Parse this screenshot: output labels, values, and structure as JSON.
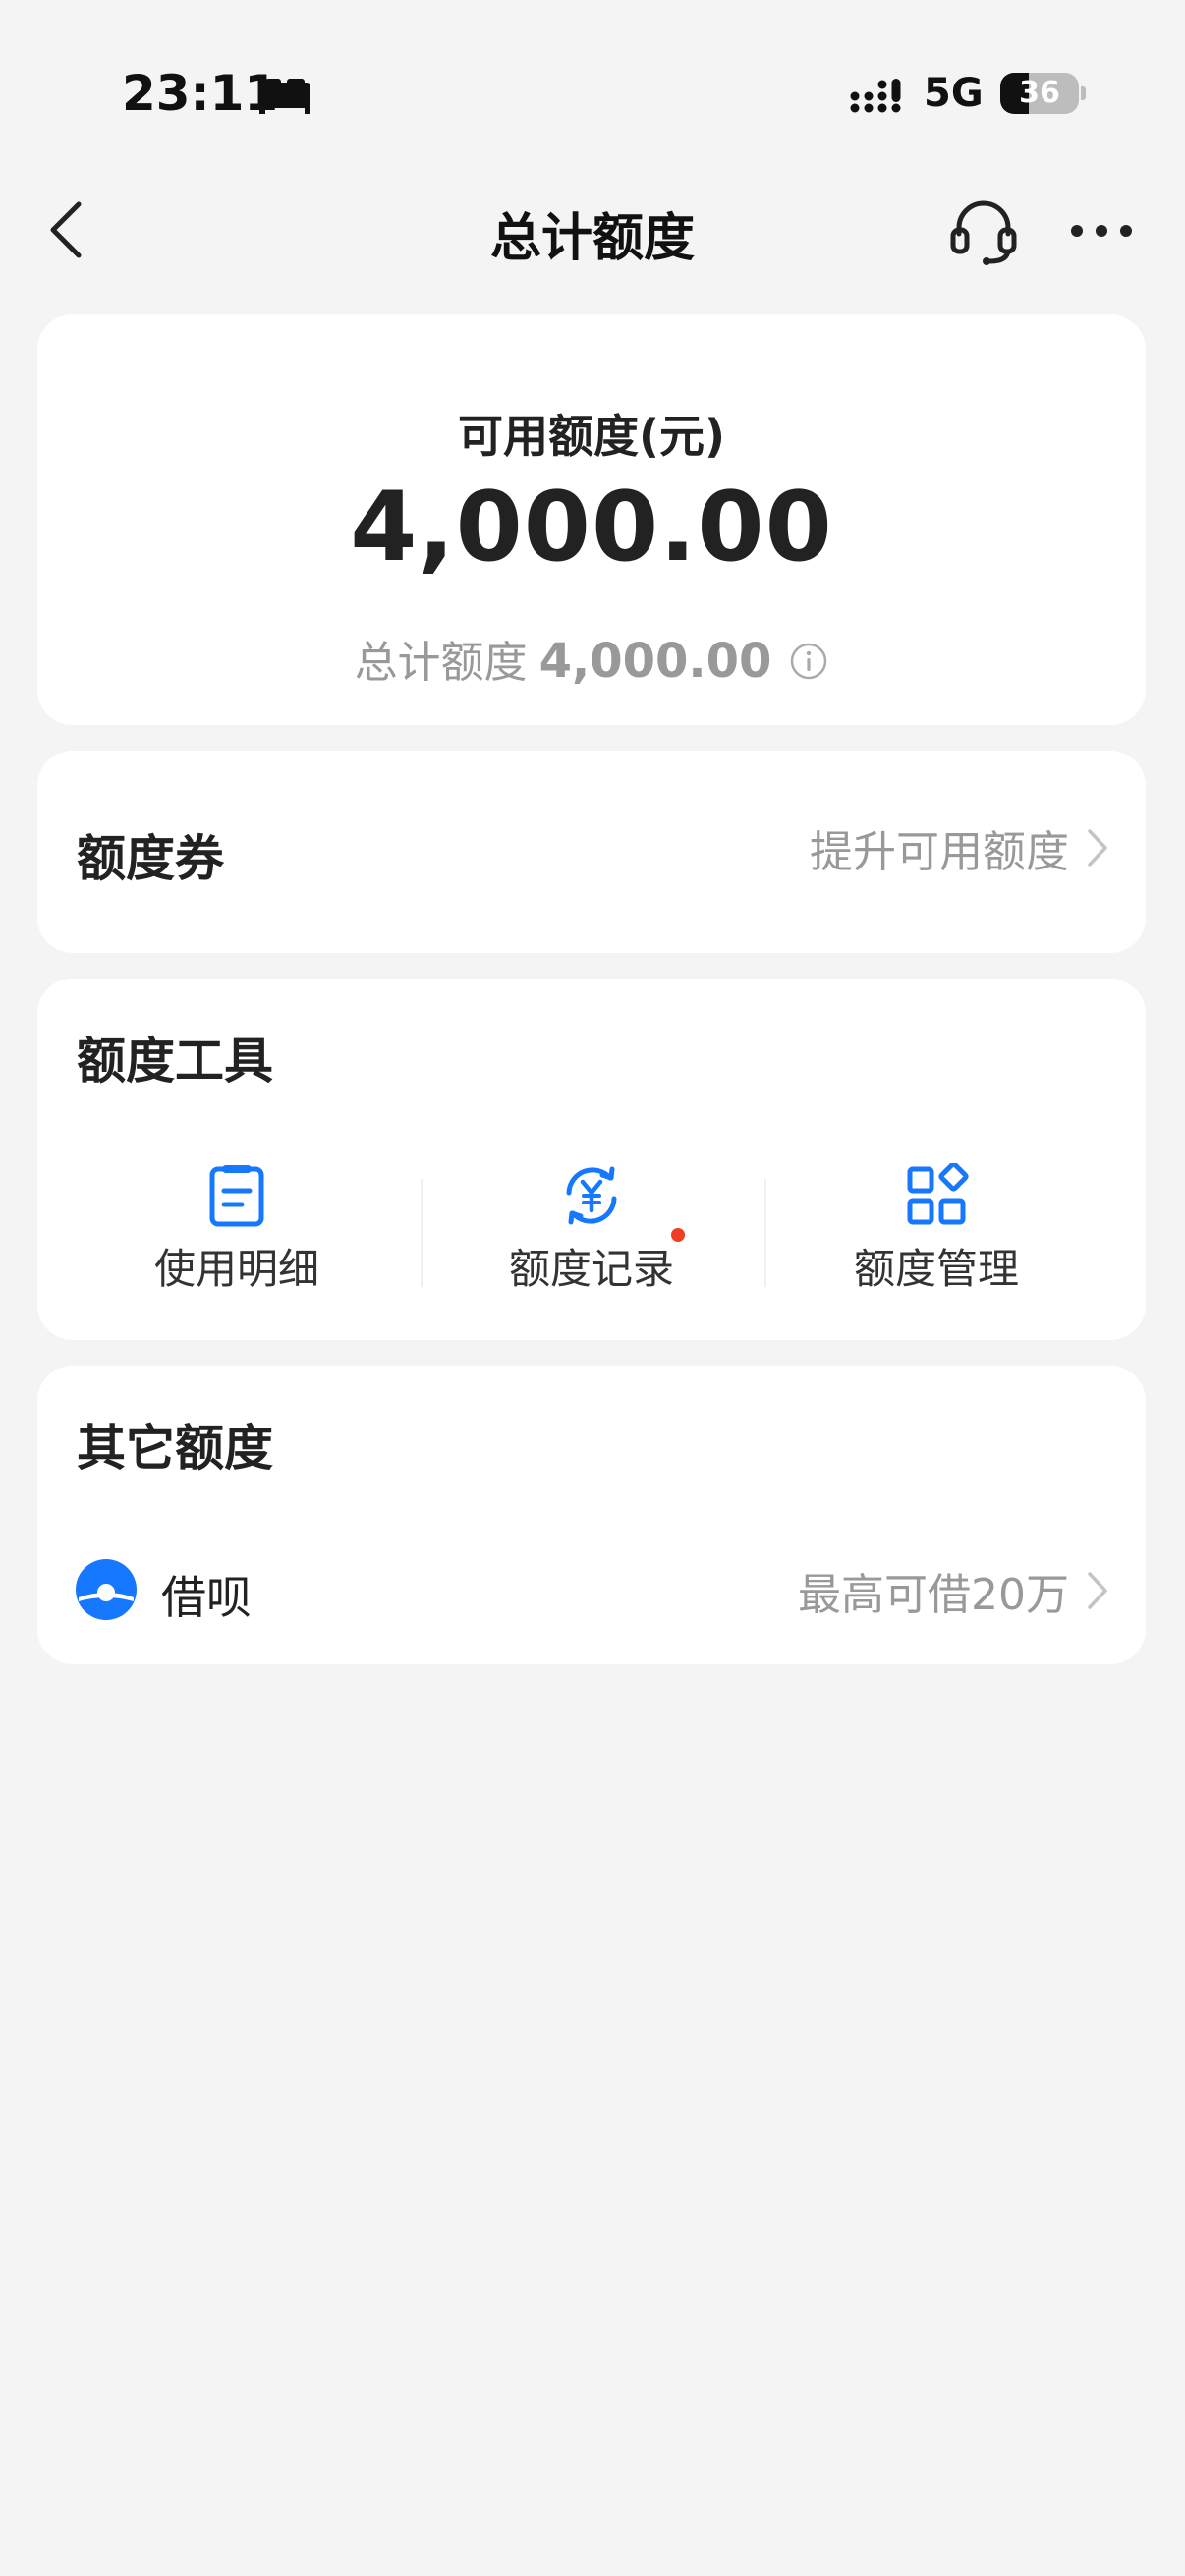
{
  "status_bar": {
    "time": "23:11",
    "network": "5G",
    "battery_level": "36",
    "battery_fraction": 0.36
  },
  "nav": {
    "title": "总计额度",
    "icons": {
      "back": "chevron-left-icon",
      "service": "headset-icon",
      "more": "more-dots-icon"
    }
  },
  "summary": {
    "available_label": "可用额度(元)",
    "available_amount": "4,000.00",
    "total_label": "总计额度",
    "total_amount": "4,000.00"
  },
  "coupon": {
    "title": "额度券",
    "link_text": "提升可用额度"
  },
  "tools": {
    "title": "额度工具",
    "items": [
      {
        "label": "使用明细",
        "icon": "document-list-icon",
        "has_dot": false
      },
      {
        "label": "额度记录",
        "icon": "yuan-refresh-icon",
        "has_dot": true
      },
      {
        "label": "额度管理",
        "icon": "grid-apps-icon",
        "has_dot": false
      }
    ]
  },
  "other": {
    "title": "其它额度",
    "items": [
      {
        "name": "借呗",
        "detail": "最高可借20万",
        "icon": "jiebei-logo-icon"
      }
    ]
  },
  "colors": {
    "page_bg": "#f4f4f4",
    "card_bg": "#ffffff",
    "accent_blue": "#1677ff",
    "badge_red": "#f03d24",
    "muted_text": "#999999"
  }
}
